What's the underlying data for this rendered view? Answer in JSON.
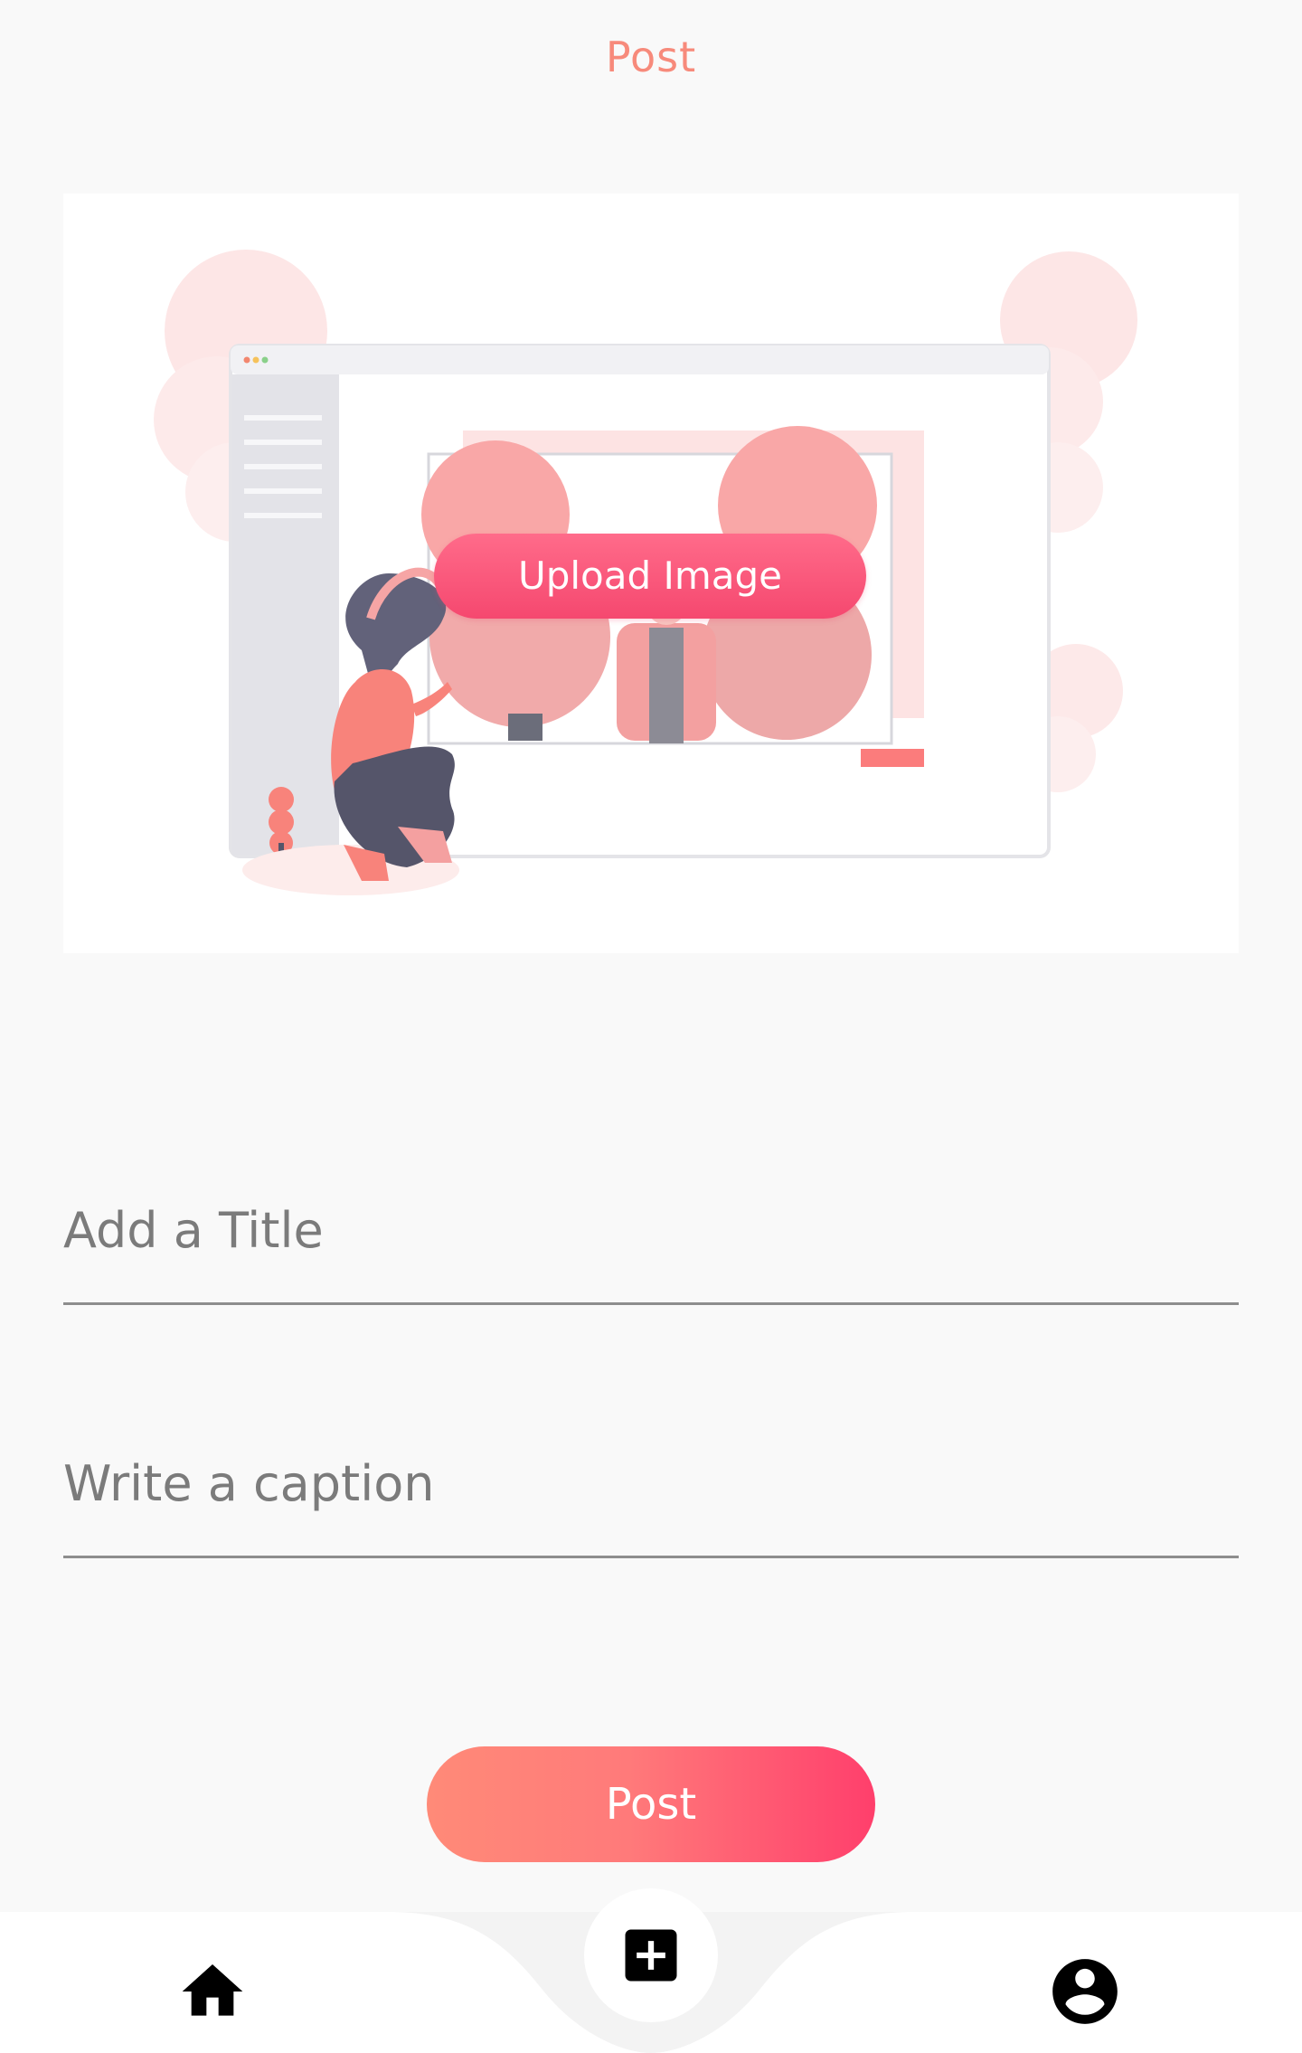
{
  "header": {
    "title": "Post"
  },
  "upload": {
    "button_label": "Upload Image",
    "illustration_icon": "image-upload-illustration"
  },
  "form": {
    "title_placeholder": "Add a Title",
    "title_value": "",
    "caption_placeholder": "Write a caption",
    "caption_value": ""
  },
  "actions": {
    "post_label": "Post"
  },
  "nav": {
    "items": [
      {
        "name": "home",
        "icon": "home-icon",
        "active": false
      },
      {
        "name": "add-post",
        "icon": "add-box-icon",
        "active": true
      },
      {
        "name": "profile",
        "icon": "account-circle-icon",
        "active": false
      }
    ]
  },
  "colors": {
    "accent": "#f78a7b",
    "gradient_start": "#ff8a78",
    "gradient_end": "#ff3f6c",
    "upload_button": "#f5486f",
    "background": "#f9f9f9"
  }
}
